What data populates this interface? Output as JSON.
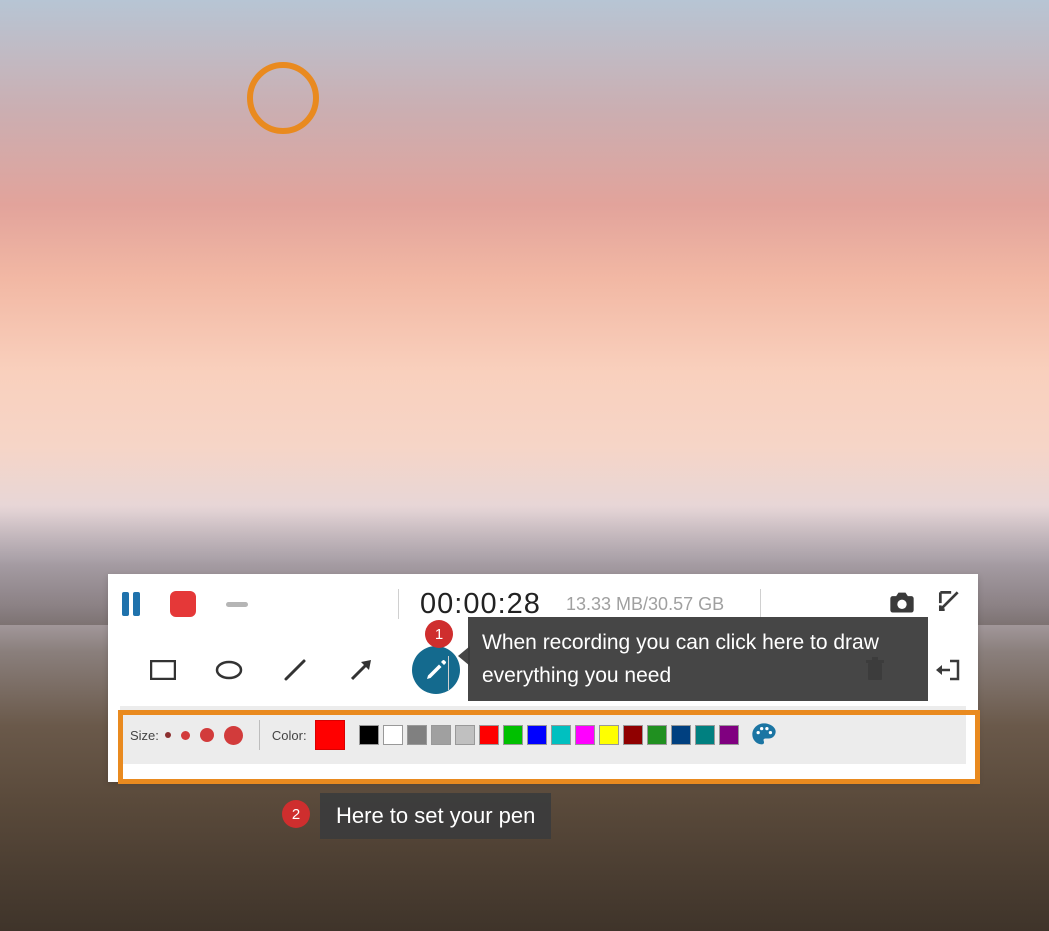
{
  "recorder": {
    "timer": "00:00:28",
    "filesize": "13.33 MB/30.57 GB"
  },
  "tools": {
    "rectangle": "rectangle",
    "ellipse": "ellipse",
    "line": "line",
    "arrow": "arrow",
    "pen": "pen",
    "trash": "trash",
    "exit": "exit"
  },
  "style": {
    "size_label": "Size:",
    "color_label": "Color:",
    "current_color": "#ff0000",
    "swatches": [
      "#000000",
      "#ffffff",
      "#808080",
      "#a0a0a0",
      "#c0c0c0",
      "#ff0000",
      "#00c000",
      "#0000ff",
      "#00c0c0",
      "#ff00ff",
      "#ffff00",
      "#900000",
      "#209020",
      "#004080",
      "#008080",
      "#800080"
    ]
  },
  "callouts": {
    "c1_num": "1",
    "c1_text": "When recording you can click here to draw everything you need",
    "c2_num": "2",
    "c2_text": "Here to set your pen"
  }
}
